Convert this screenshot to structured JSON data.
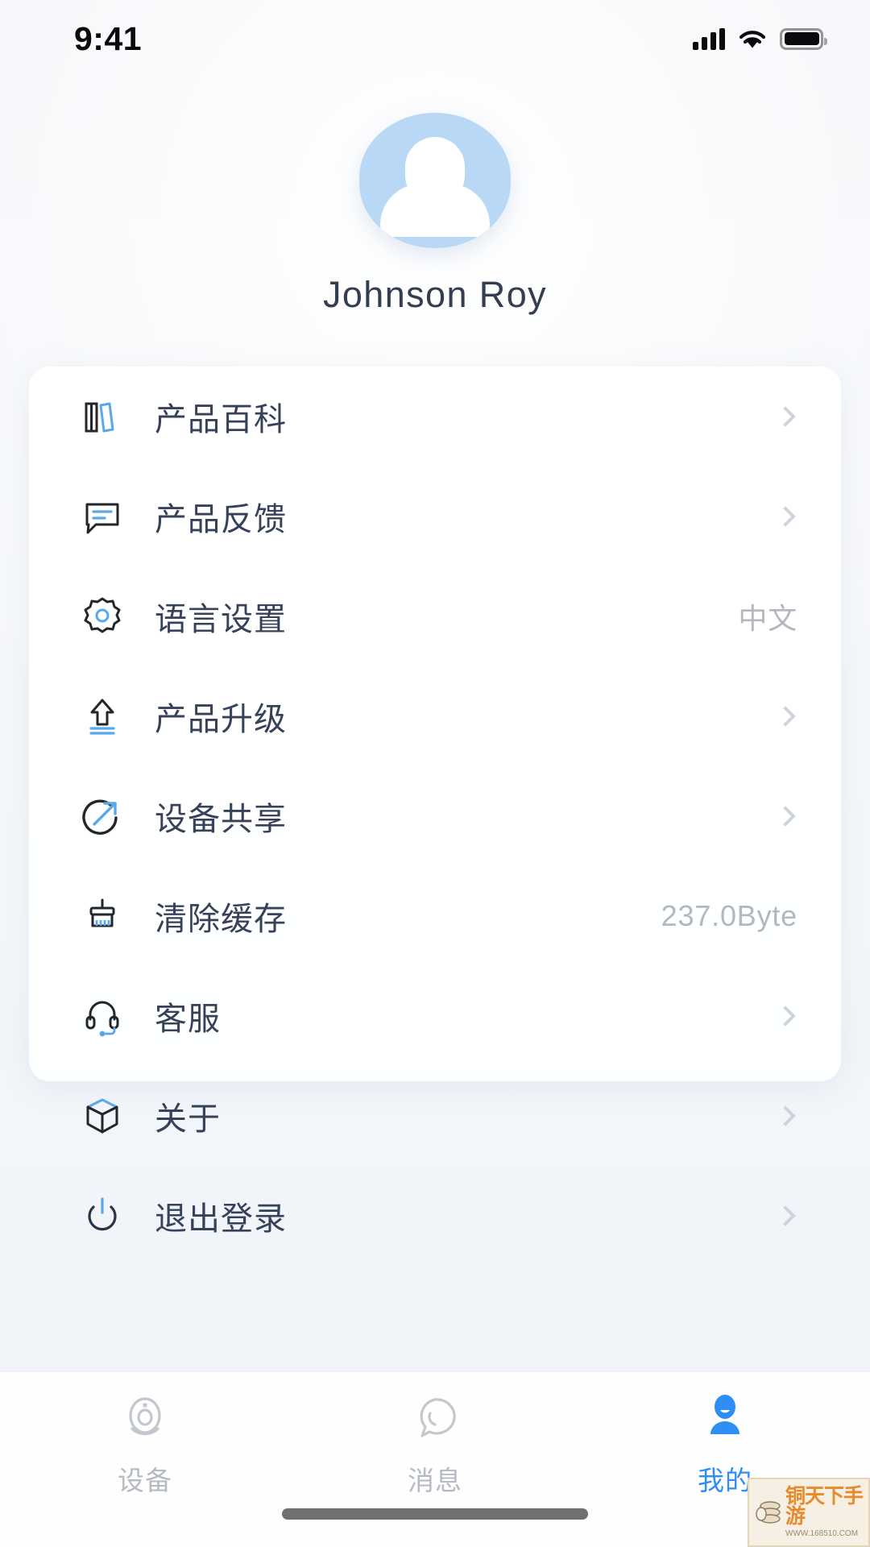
{
  "status_bar": {
    "time": "9:41",
    "signal_icon": "cellular-signal-icon",
    "wifi_icon": "wifi-icon",
    "battery_icon": "battery-icon"
  },
  "profile": {
    "avatar_icon": "user-avatar-icon",
    "name": "Johnson Roy",
    "avatar_color": "#b9d8f5"
  },
  "menu": {
    "items": [
      {
        "icon": "books-icon",
        "label": "产品百科",
        "value": "",
        "chevron": true
      },
      {
        "icon": "feedback-icon",
        "label": "产品反馈",
        "value": "",
        "chevron": true
      },
      {
        "icon": "gear-icon",
        "label": "语言设置",
        "value": "中文",
        "chevron": false
      },
      {
        "icon": "upgrade-icon",
        "label": "产品升级",
        "value": "",
        "chevron": true
      },
      {
        "icon": "share-icon",
        "label": "设备共享",
        "value": "",
        "chevron": true
      },
      {
        "icon": "broom-icon",
        "label": "清除缓存",
        "value": "237.0Byte",
        "chevron": false
      },
      {
        "icon": "headset-icon",
        "label": "客服",
        "value": "",
        "chevron": true
      },
      {
        "icon": "cube-icon",
        "label": "关于",
        "value": "",
        "chevron": true
      },
      {
        "icon": "power-icon",
        "label": "退出登录",
        "value": "",
        "chevron": true
      }
    ]
  },
  "tabbar": {
    "accent_color": "#2f8ef4",
    "inactive_color": "#b6bbc3",
    "tabs": [
      {
        "icon": "camera-device-icon",
        "label": "设备",
        "active": false
      },
      {
        "icon": "message-bubble-icon",
        "label": "消息",
        "active": false
      },
      {
        "icon": "person-icon",
        "label": "我的",
        "active": true
      }
    ]
  },
  "watermark": {
    "title": "铜天下手游",
    "url": "WWW.168510.COM",
    "icon": "coins-icon"
  }
}
